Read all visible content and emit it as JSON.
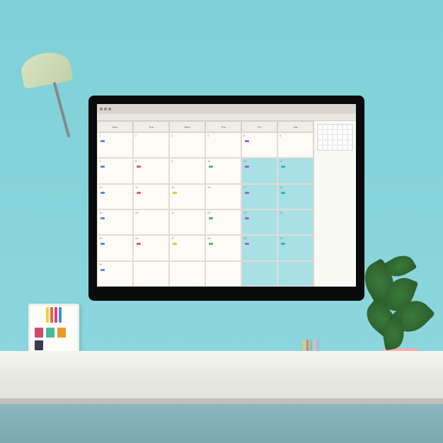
{
  "scene": {
    "description": "desk-workspace-with-monitor"
  },
  "calendar": {
    "headers": [
      "Mon",
      "Tue",
      "Wed",
      "Thu",
      "Fri",
      "Sat"
    ],
    "days": [
      "1",
      "2",
      "3",
      "4",
      "5",
      "6",
      "7",
      "8",
      "9",
      "10",
      "11",
      "12",
      "13",
      "14",
      "15",
      "16",
      "17",
      "18",
      "19",
      "20",
      "21",
      "22",
      "23",
      "24",
      "25",
      "26",
      "27",
      "28",
      "29",
      "30",
      "31",
      "",
      "",
      "",
      "",
      ""
    ],
    "highlight_cells": [
      10,
      11,
      16,
      17,
      22,
      23,
      28,
      29,
      34,
      35
    ],
    "event_colors": [
      "#4a90d9",
      "#e85a5a",
      "#f0c040",
      "#5ab85a",
      "#a060d0",
      "#40b0b0"
    ]
  },
  "colors": {
    "sticky_notes": [
      "#d04a6a",
      "#4ab89a",
      "#e89a2a",
      "#3a3a50"
    ],
    "markers": [
      "#f0d040",
      "#e86a30",
      "#d040a0",
      "#4090d0"
    ],
    "pencils": [
      "#f5c566",
      "#e87a7a",
      "#88c888",
      "#f0b0d0",
      "#a8b8d8"
    ]
  }
}
